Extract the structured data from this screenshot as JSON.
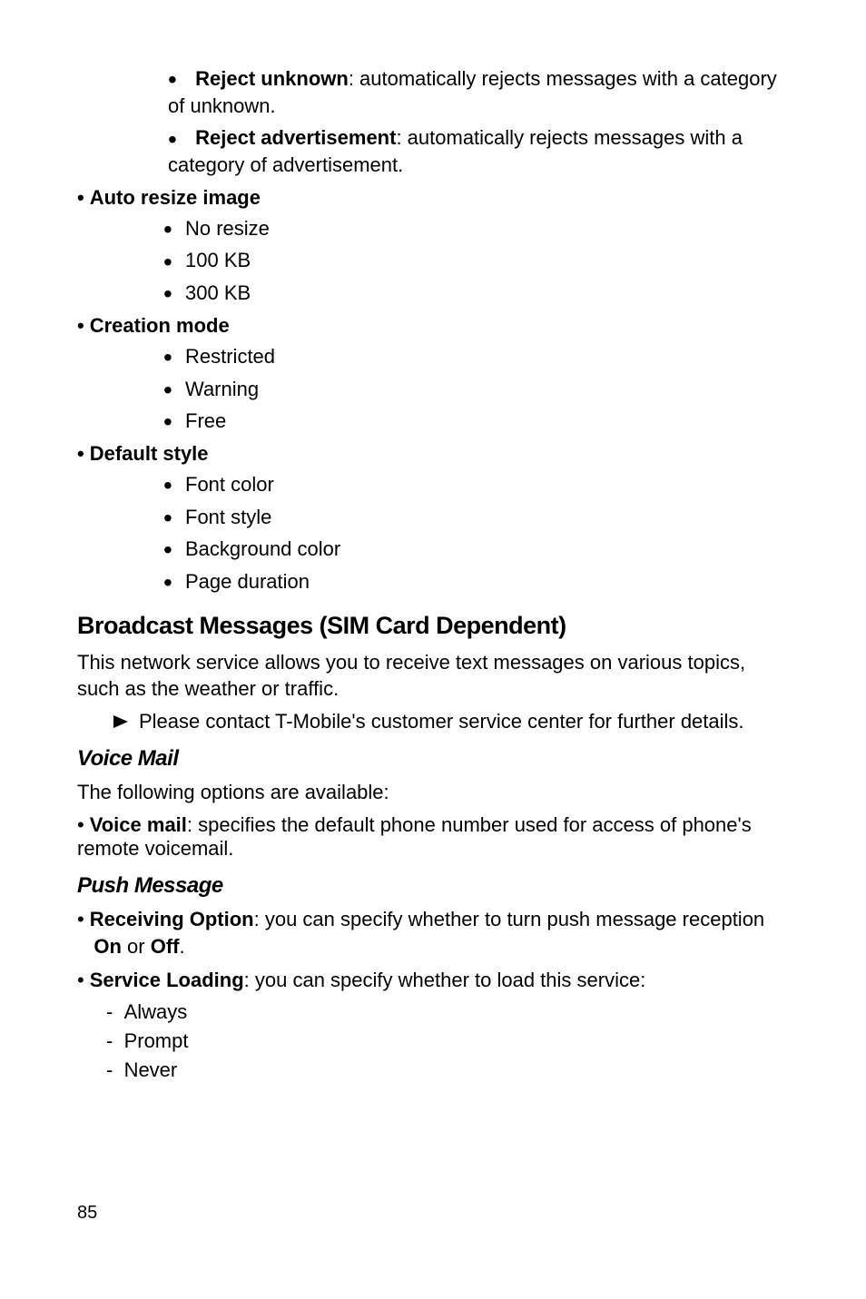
{
  "reject_unknown_label": "Reject unknown",
  "reject_unknown_desc": ": automatically rejects messages with a category of unknown.",
  "reject_ad_label": "Reject advertisement",
  "reject_ad_desc": ": automatically rejects messages with a category of advertisement.",
  "auto_resize_title": "Auto resize image",
  "auto_resize_items": {
    "i0": "No resize",
    "i1": "100 KB",
    "i2": "300 KB"
  },
  "creation_mode_title": "Creation mode",
  "creation_mode_items": {
    "i0": "Restricted",
    "i1": "Warning",
    "i2": "Free"
  },
  "default_style_title": "Default style",
  "default_style_items": {
    "i0": "Font color",
    "i1": "Font style",
    "i2": "Background color",
    "i3": "Page duration"
  },
  "broadcast_title": "Broadcast Messages (SIM Card Dependent)",
  "broadcast_para": "This network service allows you to receive text messages on various topics, such as the weather or traffic.",
  "broadcast_arrow": "Please contact T-Mobile's customer service center for further details.",
  "voicemail_title": "Voice Mail",
  "voicemail_intro": "The following options are available:",
  "voicemail_label": "Voice mail",
  "voicemail_desc": ": specifies the default phone number used for access of phone's remote voicemail.",
  "push_title": "Push Message",
  "push_recv_label": "Receiving Option",
  "push_recv_a": ": you can specify whether to turn push message reception ",
  "push_recv_on": "On",
  "push_recv_or": " or ",
  "push_recv_off": "Off",
  "push_recv_end": ".",
  "push_service_label": "Service Loading",
  "push_service_desc": ": you can specify whether to load this service:",
  "push_service_items": {
    "i0": "Always",
    "i1": "Prompt",
    "i2": "Never"
  },
  "page_number": "85"
}
